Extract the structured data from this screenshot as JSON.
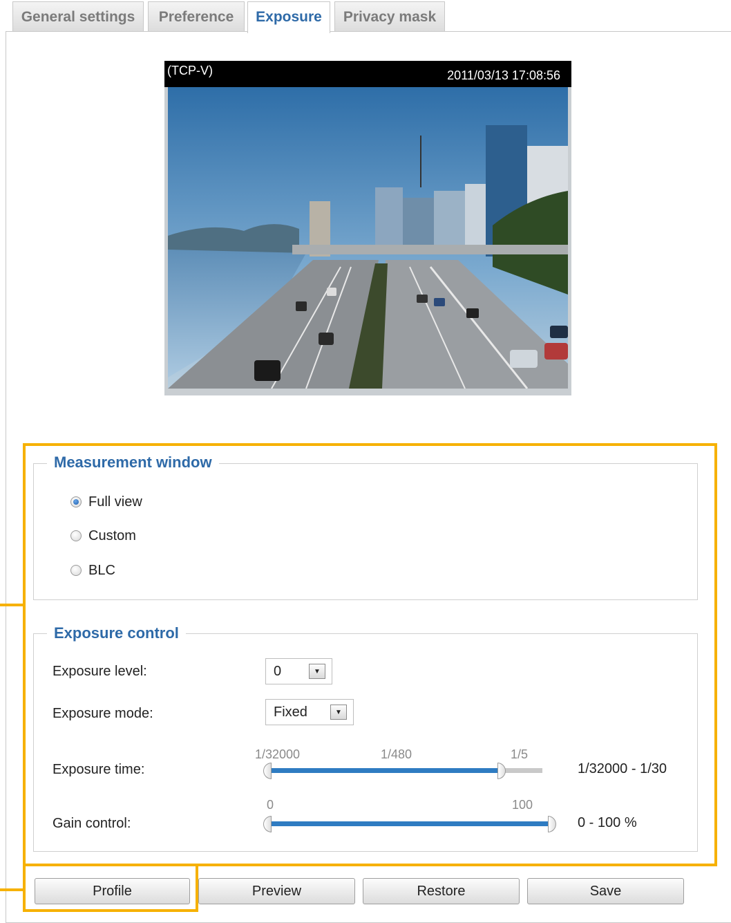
{
  "tabs": [
    {
      "label": "General settings",
      "active": false
    },
    {
      "label": "Preference",
      "active": false
    },
    {
      "label": "Exposure",
      "active": true
    },
    {
      "label": "Privacy mask",
      "active": false
    }
  ],
  "video": {
    "stream_label": "(TCP-V)",
    "timestamp": "2011/03/13  17:08:56"
  },
  "measurement_window": {
    "title": "Measurement window",
    "options": [
      {
        "label": "Full view",
        "selected": true
      },
      {
        "label": "Custom",
        "selected": false
      },
      {
        "label": "BLC",
        "selected": false
      }
    ]
  },
  "exposure_control": {
    "title": "Exposure control",
    "exposure_level": {
      "label": "Exposure level:",
      "value": "0"
    },
    "exposure_mode": {
      "label": "Exposure mode:",
      "value": "Fixed"
    },
    "exposure_time": {
      "label": "Exposure time:",
      "ticks": [
        "1/32000",
        "1/480",
        "1/5"
      ],
      "min_value": "1/32000",
      "max_value": "1/30",
      "range_text": "1/32000 - 1/30",
      "fill_fraction": 0.84
    },
    "gain_control": {
      "label": "Gain control:",
      "ticks": [
        "0",
        "100"
      ],
      "min_value": 0,
      "max_value": 100,
      "range_text": "0 - 100 %",
      "fill_fraction": 1.0
    }
  },
  "buttons": {
    "profile": "Profile",
    "preview": "Preview",
    "restore": "Restore",
    "save": "Save"
  },
  "colors": {
    "accent": "#2e6aa8",
    "callout": "#f6b100",
    "slider_fill": "#2f7cc2"
  }
}
